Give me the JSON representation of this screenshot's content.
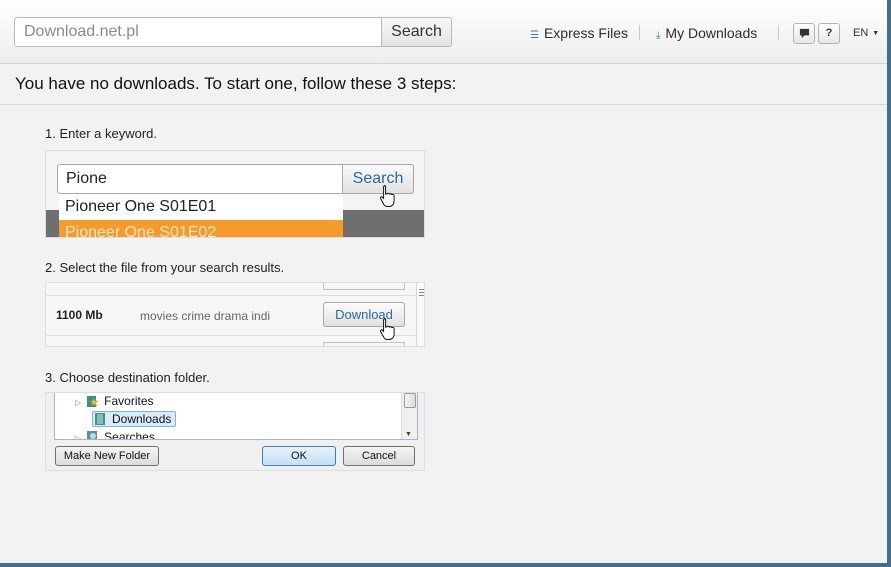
{
  "search": {
    "placeholder": "Download.net.pl",
    "button": "Search"
  },
  "nav": {
    "express_files": "Express Files",
    "my_downloads": "My Downloads",
    "feedback_icon": "speech-bubble-icon",
    "help": "?",
    "language": "EN"
  },
  "headline": "You have no downloads. To start one, follow these 3 steps:",
  "step1": {
    "label": "1. Enter a keyword.",
    "query": "Pione",
    "button": "Search",
    "suggestions": [
      "Pioneer One S01E01",
      "Pioneer One S01E02"
    ]
  },
  "step2": {
    "label": "2. Select the file from your search results.",
    "size": "1100 Mb",
    "tags": "movies crime drama indi",
    "button": "Download"
  },
  "step3": {
    "label": "3. Choose destination folder.",
    "folders": [
      "Favorites",
      "Downloads",
      "Searches"
    ],
    "new_folder": "Make New Folder",
    "ok": "OK",
    "cancel": "Cancel"
  },
  "colors": {
    "accent": "#f59b2b",
    "link": "#2c6aa0",
    "frame": "#3f6e8e"
  }
}
